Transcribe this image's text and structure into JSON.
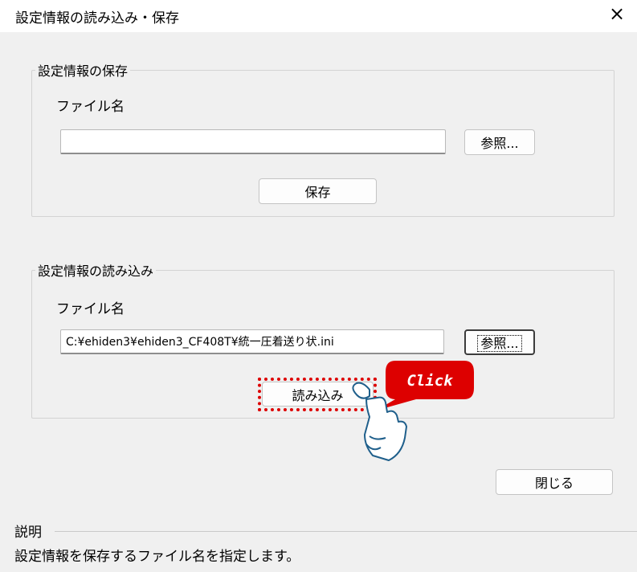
{
  "window": {
    "title": "設定情報の読み込み・保存",
    "close_glyph": "×"
  },
  "save_section": {
    "legend": "設定情報の保存",
    "file_label": "ファイル名",
    "file_value": "",
    "browse_label": "参照...",
    "save_label": "保存"
  },
  "load_section": {
    "legend": "設定情報の読み込み",
    "file_label": "ファイル名",
    "file_value": "C:¥ehiden3¥ehiden3_CF408T¥統一圧着送り状.ini",
    "browse_label": "参照...",
    "load_label": "読み込み"
  },
  "footer": {
    "close_label": "閉じる"
  },
  "description": {
    "title": "説明",
    "text": "設定情報を保存するファイル名を指定します。"
  },
  "annotation": {
    "bubble_text": "Click",
    "accent": "#dd0000"
  }
}
